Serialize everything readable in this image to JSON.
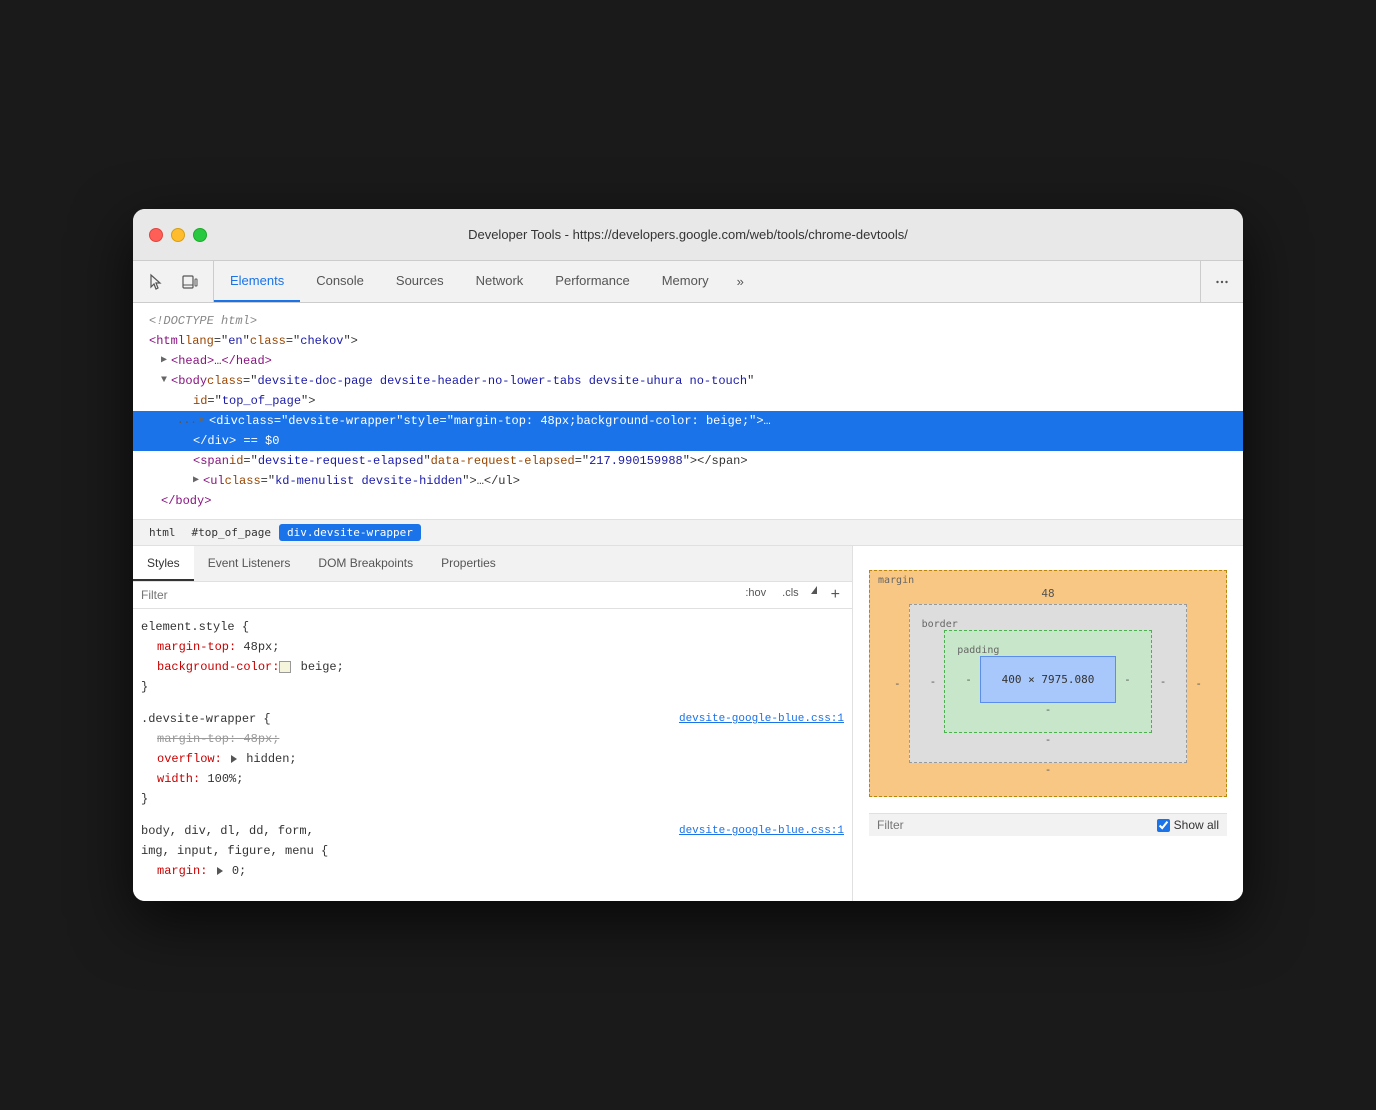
{
  "window": {
    "title": "Developer Tools - https://developers.google.com/web/tools/chrome-devtools/"
  },
  "toolbar": {
    "tabs": [
      {
        "id": "elements",
        "label": "Elements",
        "active": true
      },
      {
        "id": "console",
        "label": "Console",
        "active": false
      },
      {
        "id": "sources",
        "label": "Sources",
        "active": false
      },
      {
        "id": "network",
        "label": "Network",
        "active": false
      },
      {
        "id": "performance",
        "label": "Performance",
        "active": false
      },
      {
        "id": "memory",
        "label": "Memory",
        "active": false
      },
      {
        "id": "more",
        "label": "»",
        "active": false
      }
    ]
  },
  "dom": {
    "lines": [
      {
        "id": "doctype",
        "text": "<!DOCTYPE html>",
        "indent": 0,
        "type": "comment"
      },
      {
        "id": "html-open",
        "text": "<html lang=\"en\" class=\"chekov\">",
        "indent": 0,
        "type": "tag"
      },
      {
        "id": "head",
        "text": "▶<head>…</head>",
        "indent": 1,
        "type": "tag"
      },
      {
        "id": "body-open",
        "text": "▼<body class=\"devsite-doc-page devsite-header-no-lower-tabs devsite-uhura no-touch\"",
        "indent": 1,
        "type": "tag",
        "extra": "id=\"top_of_page\">"
      },
      {
        "id": "div-selected",
        "text": "▶<div class=\"devsite-wrapper\" style=\"margin-top: 48px;background-color: beige;\">…",
        "indent": 2,
        "type": "tag",
        "selected": true,
        "prefix": "..."
      },
      {
        "id": "div-close",
        "text": "</div> == $0",
        "indent": 3,
        "type": "tag"
      },
      {
        "id": "span",
        "text": "<span id=\"devsite-request-elapsed\" data-request-elapsed=\"217.990159988\"></span>",
        "indent": 3,
        "type": "tag"
      },
      {
        "id": "ul",
        "text": "▶<ul class=\"kd-menulist devsite-hidden\">…</ul>",
        "indent": 3,
        "type": "tag"
      },
      {
        "id": "body-close",
        "text": "</body>",
        "indent": 1,
        "type": "tag"
      }
    ]
  },
  "breadcrumbs": [
    {
      "id": "html",
      "label": "html",
      "active": false
    },
    {
      "id": "top-of-page",
      "label": "#top_of_page",
      "active": false
    },
    {
      "id": "div-wrapper",
      "label": "div.devsite-wrapper",
      "active": true
    }
  ],
  "panel_tabs": [
    {
      "id": "styles",
      "label": "Styles",
      "active": true
    },
    {
      "id": "event-listeners",
      "label": "Event Listeners",
      "active": false
    },
    {
      "id": "dom-breakpoints",
      "label": "DOM Breakpoints",
      "active": false
    },
    {
      "id": "properties",
      "label": "Properties",
      "active": false
    }
  ],
  "filter": {
    "placeholder": "Filter",
    "hov_label": ":hov",
    "cls_label": ".cls",
    "add_label": "+"
  },
  "css_rules": [
    {
      "id": "element-style",
      "selector": "element.style {",
      "properties": [
        {
          "name": "margin-top:",
          "value": "48px;",
          "strikethrough": false,
          "color": false
        },
        {
          "name": "background-color:",
          "value": "beige;",
          "strikethrough": false,
          "color": true
        }
      ],
      "close": "}"
    },
    {
      "id": "devsite-wrapper",
      "selector": ".devsite-wrapper {",
      "source": "devsite-google-blue.css:1",
      "properties": [
        {
          "name": "margin-top:",
          "value": "48px;",
          "strikethrough": true,
          "color": false
        },
        {
          "name": "overflow:",
          "value": "hidden;",
          "strikethrough": false,
          "color": false,
          "triangle": true
        },
        {
          "name": "width:",
          "value": "100%;",
          "strikethrough": false,
          "color": false
        }
      ],
      "close": "}"
    },
    {
      "id": "body-selectors",
      "selector": "body, div, dl, dd, form,",
      "selector2": "img, input, figure, menu {",
      "source": "devsite-google-blue.css:1",
      "properties": [
        {
          "name": "margin:",
          "value": "0;",
          "strikethrough": false,
          "color": false,
          "triangle": true
        }
      ]
    }
  ],
  "box_model": {
    "margin_label": "margin",
    "margin_value": "48",
    "border_label": "border",
    "border_value": "-",
    "padding_label": "padding",
    "padding_value": "-",
    "content_value": "400 × 7975.080",
    "side_dash": "-"
  },
  "computed_filter": {
    "placeholder": "Filter",
    "show_all_label": "Show all"
  }
}
